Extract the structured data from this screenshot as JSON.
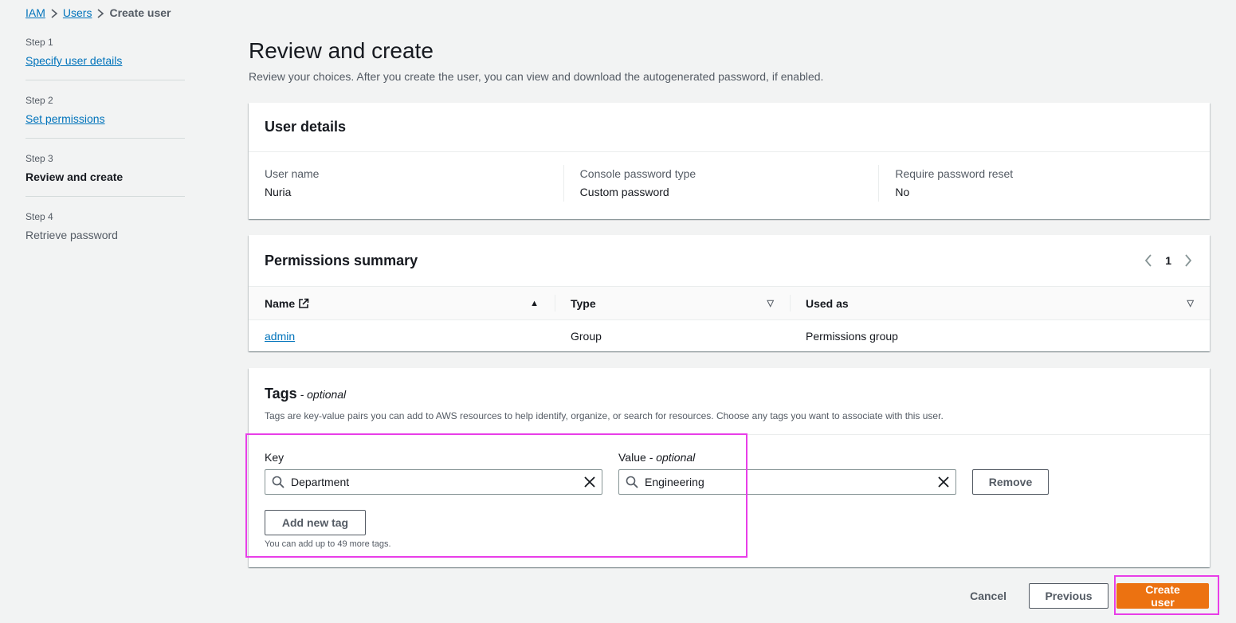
{
  "breadcrumb": {
    "items": [
      "IAM",
      "Users"
    ],
    "current": "Create user"
  },
  "wizard": {
    "steps": [
      {
        "num": "Step 1",
        "label": "Specify user details"
      },
      {
        "num": "Step 2",
        "label": "Set permissions"
      },
      {
        "num": "Step 3",
        "label": "Review and create"
      },
      {
        "num": "Step 4",
        "label": "Retrieve password"
      }
    ]
  },
  "page": {
    "title": "Review and create",
    "description": "Review your choices. After you create the user, you can view and download the autogenerated password, if enabled."
  },
  "user_details": {
    "title": "User details",
    "fields": [
      {
        "key": "User name",
        "value": "Nuria"
      },
      {
        "key": "Console password type",
        "value": "Custom password"
      },
      {
        "key": "Require password reset",
        "value": "No"
      }
    ]
  },
  "permissions": {
    "title": "Permissions summary",
    "page_number": "1",
    "columns": [
      "Name",
      "Type",
      "Used as"
    ],
    "rows": [
      {
        "name": "admin",
        "type": "Group",
        "used_as": "Permissions group"
      }
    ]
  },
  "tags": {
    "title": "Tags",
    "optional": "- optional",
    "description": "Tags are key-value pairs you can add to AWS resources to help identify, organize, or search for resources. Choose any tags you want to associate with this user.",
    "key_label": "Key",
    "value_label": "Value",
    "value_optional": "- optional",
    "key_value": "Department",
    "value_value": "Engineering",
    "remove_label": "Remove",
    "add_label": "Add new tag",
    "limit_text": "You can add up to 49 more tags."
  },
  "footer": {
    "cancel_label": "Cancel",
    "previous_label": "Previous",
    "create_label": "Create user"
  },
  "colors": {
    "link": "#0073bb",
    "primary": "#ec7211",
    "highlight": "#e83ee8",
    "background": "#f2f3f3"
  }
}
